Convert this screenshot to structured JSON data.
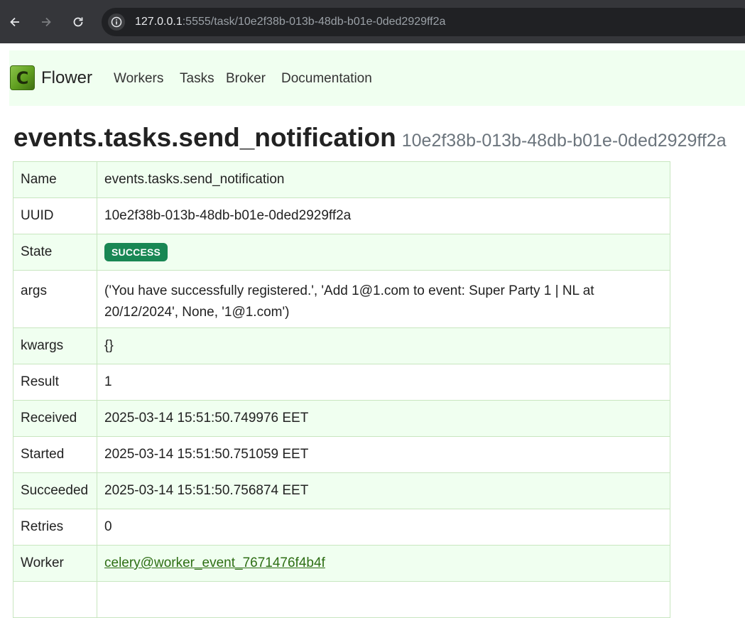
{
  "browser": {
    "url_host": "127.0.0.1",
    "url_rest": ":5555/task/10e2f38b-013b-48db-b01e-0ded2929ff2a"
  },
  "navbar": {
    "logo_letter": "C",
    "brand": "Flower",
    "links": [
      "Workers",
      "Tasks",
      "Broker",
      "Documentation"
    ]
  },
  "heading": {
    "task_name": "events.tasks.send_notification",
    "task_id": "10e2f38b-013b-48db-b01e-0ded2929ff2a"
  },
  "details": {
    "name": {
      "label": "Name",
      "value": "events.tasks.send_notification"
    },
    "uuid": {
      "label": "UUID",
      "value": "10e2f38b-013b-48db-b01e-0ded2929ff2a"
    },
    "state": {
      "label": "State",
      "value": "SUCCESS",
      "color": "#198754"
    },
    "args": {
      "label": "args",
      "line1": "('You have successfully registered.', 'Add 1@1.com to event: Super Party 1 | NL at",
      "line2": "20/12/2024', None, '1@1.com')"
    },
    "kwargs": {
      "label": "kwargs",
      "value": "{}"
    },
    "result": {
      "label": "Result",
      "value": "1"
    },
    "received": {
      "label": "Received",
      "value": "2025-03-14 15:51:50.749976 EET"
    },
    "started": {
      "label": "Started",
      "value": "2025-03-14 15:51:50.751059 EET"
    },
    "succeeded": {
      "label": "Succeeded",
      "value": "2025-03-14 15:51:50.756874 EET"
    },
    "retries": {
      "label": "Retries",
      "value": "0"
    },
    "worker": {
      "label": "Worker",
      "value": "celery@worker_event_7671476f4b4f"
    }
  }
}
